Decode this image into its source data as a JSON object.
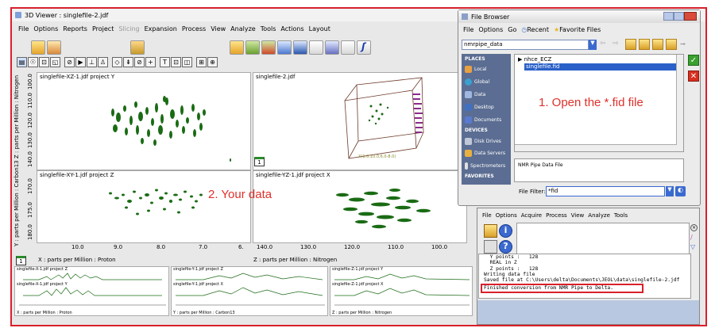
{
  "main_window": {
    "title": "3D Viewer : singlefile-2.jdf",
    "menu": [
      "File",
      "Options",
      "Reports",
      "Project",
      "Slicing",
      "Expansion",
      "Process",
      "View",
      "Analyze",
      "Tools",
      "Actions",
      "Layout"
    ],
    "dim_menu": "Slicing"
  },
  "panes": {
    "top_left": {
      "label": "singlefile-XZ-1.jdf project Y",
      "yticks": [
        "100.0",
        "110.0",
        "120.0",
        "130.0",
        "140.0"
      ]
    },
    "top_right": {
      "label": "singlefile-2.jdf",
      "cube_axis_label": "X(1.0,10.0,6.0-8.0)"
    },
    "bottom_left": {
      "label": "singlefile-XY-1.jdf project Z",
      "yticks": [
        "170.0",
        "175.0",
        "180.0"
      ]
    },
    "bottom_right": {
      "label": "singlefile-YZ-1.jdf project X"
    },
    "left_vaxis": "Y : parts per Million : Carbon13   Z : parts per Million : Nitrogen",
    "x_ticks_left": [
      "10.0",
      "9.0",
      "8.0",
      "7.0",
      "6."
    ],
    "x_ticks_right": [
      "140.0",
      "130.0",
      "120.0",
      "110.0",
      "100.0"
    ],
    "x_label_left": "X : parts per Million : Proton",
    "x_label_right": "Z : parts per Million : Nitrogen",
    "corner_badge": "1",
    "plot_color": "#1a6b14"
  },
  "traces": {
    "labels": [
      "singlefile-X-1.jdf project Z",
      "singlefile-Y-1.jdf project Z",
      "singlefile-Z-1.jdf project Y",
      "singlefile-X-1.jdf project Y",
      "singlefile-Y-1.jdf project X",
      "singlefile-Z-1.jdf project X"
    ],
    "bottom_labels": [
      "X : parts per Million : Proton",
      "Y : parts per Million : Carbon13",
      "Z : parts per Million : Nitrogen"
    ]
  },
  "file_browser": {
    "title": "File Browser",
    "menu": [
      "File",
      "Options",
      "Go",
      "Recent",
      "Favorite Files"
    ],
    "path": "nmrpipe_data",
    "places_header": "PLACES",
    "places": [
      "Local",
      "Global",
      "Data",
      "Desktop",
      "Documents"
    ],
    "devices_header": "DEVICES",
    "devices": [
      "Disk Drives",
      "Data Servers",
      "Spectrometers"
    ],
    "favorites_header": "FAVORITES",
    "files": [
      "nhce_ECZ",
      "singlefile.fid"
    ],
    "file_type": "NMR Pipe Data File",
    "filter_label": "File Filter:",
    "filter_value": "*fid"
  },
  "converter": {
    "menu": [
      "File",
      "Options",
      "Acquire",
      "Process",
      "View",
      "Analyze",
      "Tools"
    ],
    "console_lines": [
      "  Y points :   128",
      "  REAL in Z",
      "  Z points :   128",
      "Writing data file",
      "Saved file at C:\\Users\\delta\\Documents\\JEOL\\data\\singlefile-2.jdf",
      "Finished conversion from NMR Pipe to Delta."
    ]
  },
  "annotations": {
    "step1": "1. Open the *.fid file",
    "step2": "2. Your data",
    "color": "#e0302a"
  }
}
